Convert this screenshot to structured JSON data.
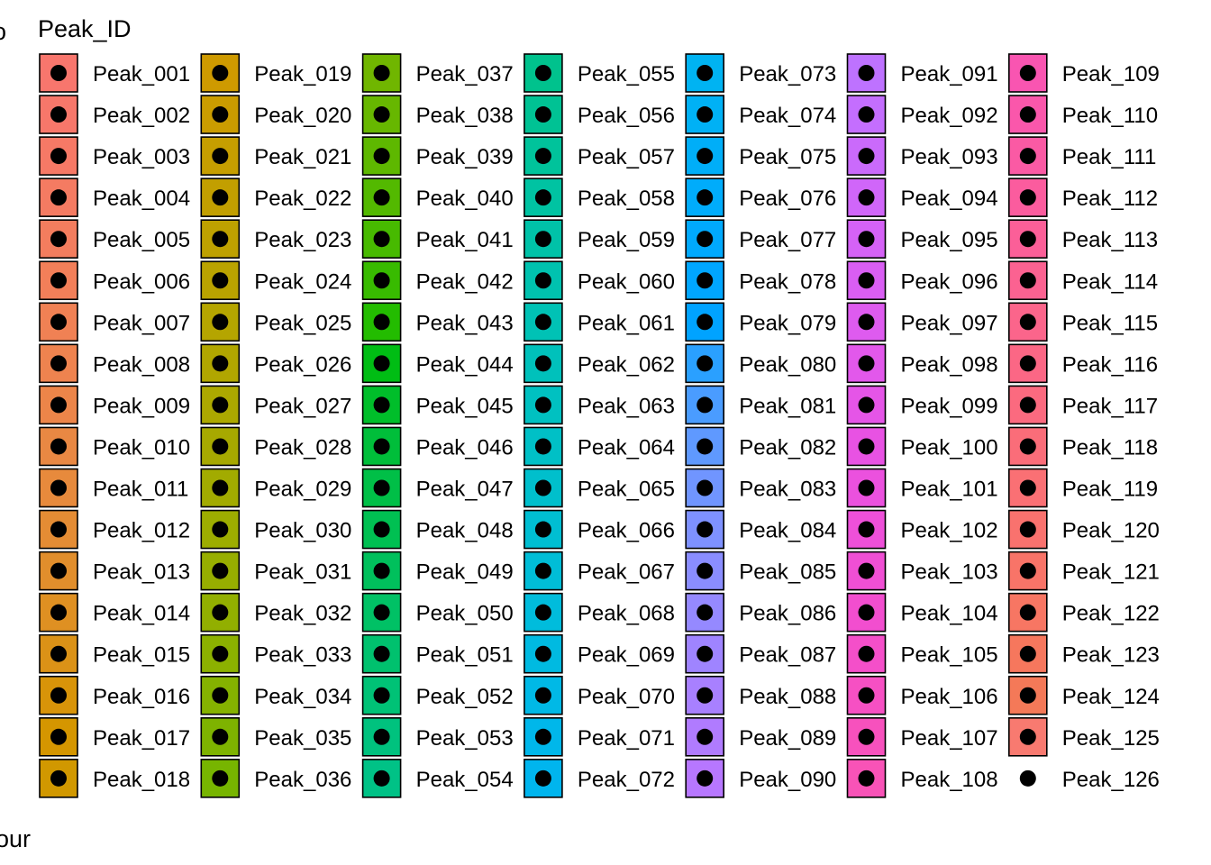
{
  "chart_data": {
    "type": "legend",
    "legend_title": "Peak_ID",
    "key_glyph": "filled-square-with-black-point",
    "point_color": "#000000",
    "key_border_color": "#000000",
    "layout": {
      "columns": 8,
      "rows": 18,
      "fill_order": "column-major"
    },
    "entries": [
      {
        "label": "Peak_001",
        "color": "#F8766D"
      },
      {
        "label": "Peak_002",
        "color": "#F7776A"
      },
      {
        "label": "Peak_003",
        "color": "#F67966"
      },
      {
        "label": "Peak_004",
        "color": "#F47B62"
      },
      {
        "label": "Peak_005",
        "color": "#F37D5E"
      },
      {
        "label": "Peak_006",
        "color": "#F27F59"
      },
      {
        "label": "Peak_007",
        "color": "#F08154"
      },
      {
        "label": "Peak_008",
        "color": "#EE834F"
      },
      {
        "label": "Peak_009",
        "color": "#EC8549"
      },
      {
        "label": "Peak_010",
        "color": "#E98843"
      },
      {
        "label": "Peak_011",
        "color": "#E78A3C"
      },
      {
        "label": "Peak_012",
        "color": "#E48C34"
      },
      {
        "label": "Peak_013",
        "color": "#E18E2C"
      },
      {
        "label": "Peak_014",
        "color": "#DF9022"
      },
      {
        "label": "Peak_015",
        "color": "#DB9217"
      },
      {
        "label": "Peak_016",
        "color": "#D89409"
      },
      {
        "label": "Peak_017",
        "color": "#D59600"
      },
      {
        "label": "Peak_018",
        "color": "#D19800"
      },
      {
        "label": "Peak_019",
        "color": "#CE9A00"
      },
      {
        "label": "Peak_020",
        "color": "#CA9C00"
      },
      {
        "label": "Peak_021",
        "color": "#C69E00"
      },
      {
        "label": "Peak_022",
        "color": "#C29F00"
      },
      {
        "label": "Peak_023",
        "color": "#BEA100"
      },
      {
        "label": "Peak_024",
        "color": "#BAA300"
      },
      {
        "label": "Peak_025",
        "color": "#B5A500"
      },
      {
        "label": "Peak_026",
        "color": "#B1A600"
      },
      {
        "label": "Peak_027",
        "color": "#ACA800"
      },
      {
        "label": "Peak_028",
        "color": "#A7A900"
      },
      {
        "label": "Peak_029",
        "color": "#A2AB00"
      },
      {
        "label": "Peak_030",
        "color": "#9DAD00"
      },
      {
        "label": "Peak_031",
        "color": "#97AE00"
      },
      {
        "label": "Peak_032",
        "color": "#92AF00"
      },
      {
        "label": "Peak_033",
        "color": "#8CB100"
      },
      {
        "label": "Peak_034",
        "color": "#85B200"
      },
      {
        "label": "Peak_035",
        "color": "#7EB300"
      },
      {
        "label": "Peak_036",
        "color": "#77B500"
      },
      {
        "label": "Peak_037",
        "color": "#70B600"
      },
      {
        "label": "Peak_038",
        "color": "#67B700"
      },
      {
        "label": "Peak_039",
        "color": "#5EB800"
      },
      {
        "label": "Peak_040",
        "color": "#53B900"
      },
      {
        "label": "Peak_041",
        "color": "#47BA00"
      },
      {
        "label": "Peak_042",
        "color": "#38BB00"
      },
      {
        "label": "Peak_043",
        "color": "#23BC00"
      },
      {
        "label": "Peak_044",
        "color": "#00BD14"
      },
      {
        "label": "Peak_045",
        "color": "#00BE2A"
      },
      {
        "label": "Peak_046",
        "color": "#00BE3A"
      },
      {
        "label": "Peak_047",
        "color": "#00BF47"
      },
      {
        "label": "Peak_048",
        "color": "#00C052"
      },
      {
        "label": "Peak_049",
        "color": "#00C05C"
      },
      {
        "label": "Peak_050",
        "color": "#00C165"
      },
      {
        "label": "Peak_051",
        "color": "#00C16E"
      },
      {
        "label": "Peak_052",
        "color": "#00C276"
      },
      {
        "label": "Peak_053",
        "color": "#00C27E"
      },
      {
        "label": "Peak_054",
        "color": "#00C286"
      },
      {
        "label": "Peak_055",
        "color": "#00C28D"
      },
      {
        "label": "Peak_056",
        "color": "#00C294"
      },
      {
        "label": "Peak_057",
        "color": "#00C39B"
      },
      {
        "label": "Peak_058",
        "color": "#00C3A2"
      },
      {
        "label": "Peak_059",
        "color": "#00C2A8"
      },
      {
        "label": "Peak_060",
        "color": "#00C2AF"
      },
      {
        "label": "Peak_061",
        "color": "#00C2B5"
      },
      {
        "label": "Peak_062",
        "color": "#00C1BB"
      },
      {
        "label": "Peak_063",
        "color": "#00C1C1"
      },
      {
        "label": "Peak_064",
        "color": "#00C0C6"
      },
      {
        "label": "Peak_065",
        "color": "#00BFCC"
      },
      {
        "label": "Peak_066",
        "color": "#00BED2"
      },
      {
        "label": "Peak_067",
        "color": "#00BDD7"
      },
      {
        "label": "Peak_068",
        "color": "#00BCDC"
      },
      {
        "label": "Peak_069",
        "color": "#00BAE1"
      },
      {
        "label": "Peak_070",
        "color": "#00B9E6"
      },
      {
        "label": "Peak_071",
        "color": "#00B7EA"
      },
      {
        "label": "Peak_072",
        "color": "#00B5EE"
      },
      {
        "label": "Peak_073",
        "color": "#00B3F2"
      },
      {
        "label": "Peak_074",
        "color": "#00B1F5"
      },
      {
        "label": "Peak_075",
        "color": "#00AEF8"
      },
      {
        "label": "Peak_076",
        "color": "#00ACFB"
      },
      {
        "label": "Peak_077",
        "color": "#00A9FD"
      },
      {
        "label": "Peak_078",
        "color": "#00A6FF"
      },
      {
        "label": "Peak_079",
        "color": "#00A3FF"
      },
      {
        "label": "Peak_080",
        "color": "#2AA0FF"
      },
      {
        "label": "Peak_081",
        "color": "#4A9CFF"
      },
      {
        "label": "Peak_082",
        "color": "#5F99FF"
      },
      {
        "label": "Peak_083",
        "color": "#7095FF"
      },
      {
        "label": "Peak_084",
        "color": "#7E91FF"
      },
      {
        "label": "Peak_085",
        "color": "#8A8DFF"
      },
      {
        "label": "Peak_086",
        "color": "#9589FF"
      },
      {
        "label": "Peak_087",
        "color": "#9F84FF"
      },
      {
        "label": "Peak_088",
        "color": "#A880FF"
      },
      {
        "label": "Peak_089",
        "color": "#B07BFF"
      },
      {
        "label": "Peak_090",
        "color": "#B777FF"
      },
      {
        "label": "Peak_091",
        "color": "#BE72FF"
      },
      {
        "label": "Peak_092",
        "color": "#C46EFE"
      },
      {
        "label": "Peak_093",
        "color": "#CA6AFB"
      },
      {
        "label": "Peak_094",
        "color": "#D066F9"
      },
      {
        "label": "Peak_095",
        "color": "#D562F6"
      },
      {
        "label": "Peak_096",
        "color": "#D95EF3"
      },
      {
        "label": "Peak_097",
        "color": "#DE5BEF"
      },
      {
        "label": "Peak_098",
        "color": "#E258EB"
      },
      {
        "label": "Peak_099",
        "color": "#E555E7"
      },
      {
        "label": "Peak_100",
        "color": "#E852E3"
      },
      {
        "label": "Peak_101",
        "color": "#EB51DE"
      },
      {
        "label": "Peak_102",
        "color": "#EE50D9"
      },
      {
        "label": "Peak_103",
        "color": "#F04FD4"
      },
      {
        "label": "Peak_104",
        "color": "#F24ECF"
      },
      {
        "label": "Peak_105",
        "color": "#F44FC9"
      },
      {
        "label": "Peak_106",
        "color": "#F650C3"
      },
      {
        "label": "Peak_107",
        "color": "#F751BD"
      },
      {
        "label": "Peak_108",
        "color": "#F853B7"
      },
      {
        "label": "Peak_109",
        "color": "#F955B1"
      },
      {
        "label": "Peak_110",
        "color": "#FA57AB"
      },
      {
        "label": "Peak_111",
        "color": "#FA5AA4"
      },
      {
        "label": "Peak_112",
        "color": "#FB5C9E"
      },
      {
        "label": "Peak_113",
        "color": "#FB5F98"
      },
      {
        "label": "Peak_114",
        "color": "#FB6291"
      },
      {
        "label": "Peak_115",
        "color": "#FB658B"
      },
      {
        "label": "Peak_116",
        "color": "#FB6785"
      },
      {
        "label": "Peak_117",
        "color": "#FB6A7F"
      },
      {
        "label": "Peak_118",
        "color": "#FA6D79"
      },
      {
        "label": "Peak_119",
        "color": "#FA7074"
      },
      {
        "label": "Peak_120",
        "color": "#F9726E"
      },
      {
        "label": "Peak_121",
        "color": "#F87468"
      },
      {
        "label": "Peak_122",
        "color": "#F77663"
      },
      {
        "label": "Peak_123",
        "color": "#F6775D"
      },
      {
        "label": "Peak_124",
        "color": "#F47958"
      },
      {
        "label": "Peak_125",
        "color": "#F87A70"
      },
      {
        "label": "Peak_126",
        "color": null
      }
    ]
  },
  "edge_text": {
    "top_left_glyph": "o",
    "left_glyph": "l",
    "bottom_left_text": "our"
  }
}
